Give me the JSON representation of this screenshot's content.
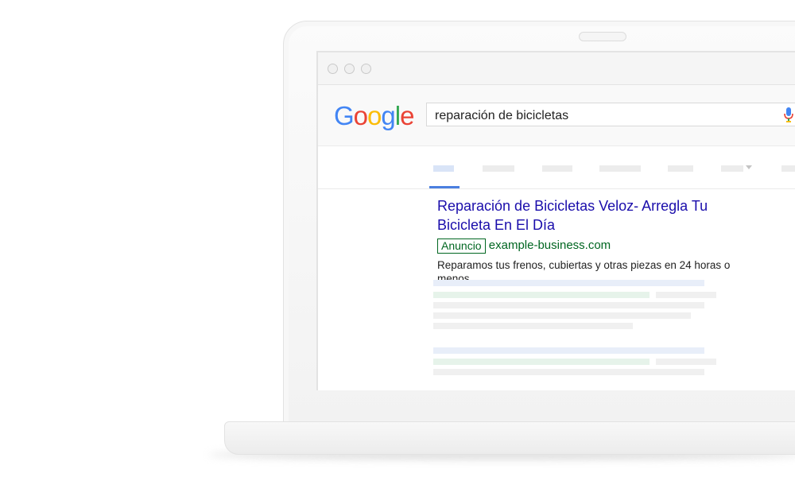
{
  "logo": {
    "text": "Google",
    "colors": [
      "#4285F4",
      "#EA4335",
      "#FBBC05",
      "#4285F4",
      "#34A853",
      "#EA4335"
    ]
  },
  "search": {
    "query": "reparación de bicicletas"
  },
  "ad": {
    "title": "Reparación de Bicicletas Veloz- Arregla Tu Bicicleta En El Día",
    "badge": "Anuncio",
    "url": "example-business.com",
    "description": "Reparamos tus frenos, cubiertas y otras piezas en 24 horas o menos."
  },
  "colors": {
    "title_link": "#1a0dab",
    "url_green": "#006621",
    "active_tab": "#4a7fe0"
  },
  "icons": {
    "mic": "microphone-icon"
  }
}
